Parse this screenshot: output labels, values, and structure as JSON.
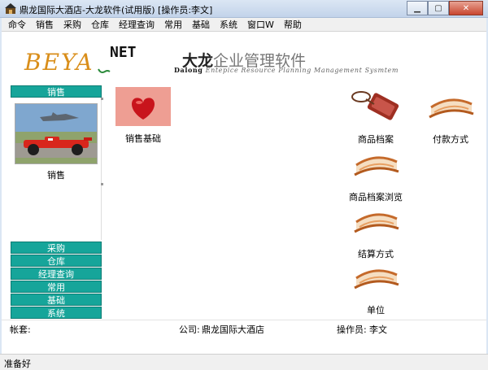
{
  "window": {
    "title": "鼎龙国际大酒店-大龙软件(试用版) [操作员:李文]"
  },
  "menu": [
    "命令",
    "销售",
    "采购",
    "仓库",
    "经理查询",
    "常用",
    "基础",
    "系统",
    "窗口W",
    "帮助"
  ],
  "logo": {
    "beya": "BEYA",
    "net": "NET"
  },
  "brand": {
    "cn_bold": "大龙",
    "cn_rest": "企业管理软件",
    "en_bold": "Dalong",
    "en_rest": " Entepice Resource Planning Management Sysmtem"
  },
  "sidebar": {
    "active_header": "销售",
    "active_caption": "销售",
    "buttons": [
      "采购",
      "仓库",
      "经理查询",
      "常用",
      "基础",
      "系统"
    ]
  },
  "items": {
    "sales_basic": "销售基础",
    "product_archive": "商品档案",
    "payment_method": "付款方式",
    "product_browse": "商品档案浏览",
    "settlement": "结算方式",
    "unit": "单位"
  },
  "info": {
    "account_label": "帐套:",
    "company_label": "公司:",
    "company_value": "鼎龙国际大酒店",
    "operator_label": "操作员:",
    "operator_value": "李文"
  },
  "status": {
    "text": "准备好"
  },
  "colors": {
    "sidebar_accent": "#16a59a",
    "logo_orange": "#d98e1a"
  }
}
